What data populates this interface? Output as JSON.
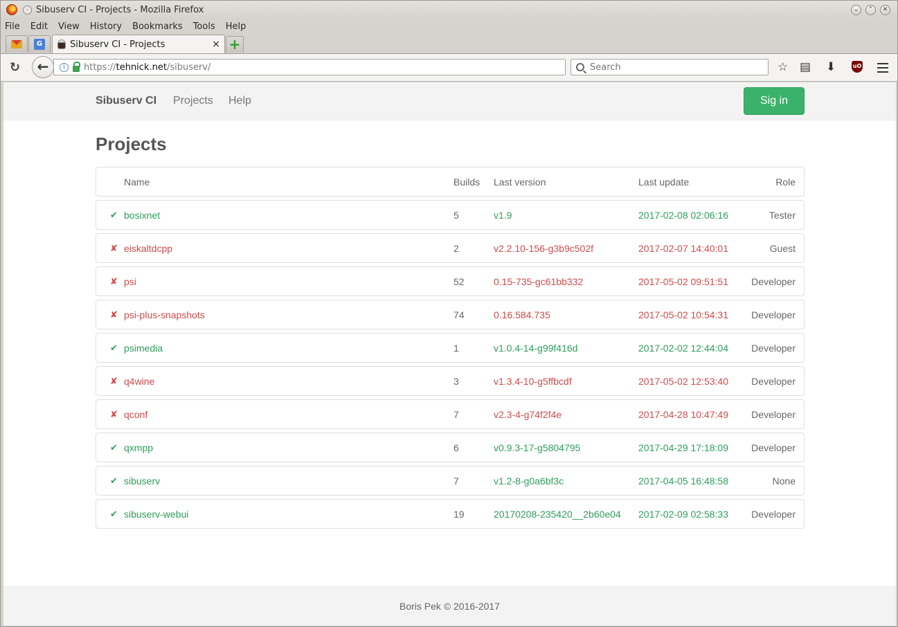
{
  "window": {
    "title": "Sibuserv CI - Projects - Mozilla Firefox"
  },
  "menu": {
    "items": [
      "File",
      "Edit",
      "View",
      "History",
      "Bookmarks",
      "Tools",
      "Help"
    ]
  },
  "tabs": {
    "active_label": "Sibuserv CI - Projects",
    "close": "×",
    "new": "+"
  },
  "urlbar": {
    "prefix": "https://",
    "host": "tehnick.net",
    "path": "/sibuserv/"
  },
  "search": {
    "placeholder": "Search"
  },
  "site": {
    "brand": "Sibuserv CI",
    "nav": [
      "Projects",
      "Help"
    ],
    "signin": "Sig in",
    "page_title": "Projects",
    "footer": "Boris Pek © 2016-2017"
  },
  "table": {
    "headers": {
      "name": "Name",
      "builds": "Builds",
      "version": "Last version",
      "update": "Last update",
      "role": "Role"
    },
    "rows": [
      {
        "status": "ok",
        "icon": "✔",
        "name": "bosixnet",
        "builds": "5",
        "version": "v1.9",
        "update": "2017-02-08 02:06:16",
        "role": "Tester"
      },
      {
        "status": "fail",
        "icon": "✘",
        "name": "eiskaltdcpp",
        "builds": "2",
        "version": "v2.2.10-156-g3b9c502f",
        "update": "2017-02-07 14:40:01",
        "role": "Guest"
      },
      {
        "status": "fail",
        "icon": "✘",
        "name": "psi",
        "builds": "52",
        "version": "0.15-735-gc61bb332",
        "update": "2017-05-02 09:51:51",
        "role": "Developer"
      },
      {
        "status": "fail",
        "icon": "✘",
        "name": "psi-plus-snapshots",
        "builds": "74",
        "version": "0.16.584.735",
        "update": "2017-05-02 10:54:31",
        "role": "Developer"
      },
      {
        "status": "ok",
        "icon": "✔",
        "name": "psimedia",
        "builds": "1",
        "version": "v1.0.4-14-g99f416d",
        "update": "2017-02-02 12:44:04",
        "role": "Developer"
      },
      {
        "status": "fail",
        "icon": "✘",
        "name": "q4wine",
        "builds": "3",
        "version": "v1.3.4-10-g5ffbcdf",
        "update": "2017-05-02 12:53:40",
        "role": "Developer"
      },
      {
        "status": "fail",
        "icon": "✘",
        "name": "qconf",
        "builds": "7",
        "version": "v2.3-4-g74f2f4e",
        "update": "2017-04-28 10:47:49",
        "role": "Developer"
      },
      {
        "status": "ok",
        "icon": "✔",
        "name": "qxmpp",
        "builds": "6",
        "version": "v0.9.3-17-g5804795",
        "update": "2017-04-29 17:18:09",
        "role": "Developer"
      },
      {
        "status": "ok",
        "icon": "✔",
        "name": "sibuserv",
        "builds": "7",
        "version": "v1.2-8-g0a6bf3c",
        "update": "2017-04-05 16:48:58",
        "role": "None"
      },
      {
        "status": "ok",
        "icon": "✔",
        "name": "sibuserv-webui",
        "builds": "19",
        "version": "20170208-235420__2b60e04",
        "update": "2017-02-09 02:58:33",
        "role": "Developer"
      }
    ]
  },
  "colors": {
    "ok": "#2e9e5c",
    "fail": "#d24a4a",
    "signin": "#3bb26b"
  }
}
